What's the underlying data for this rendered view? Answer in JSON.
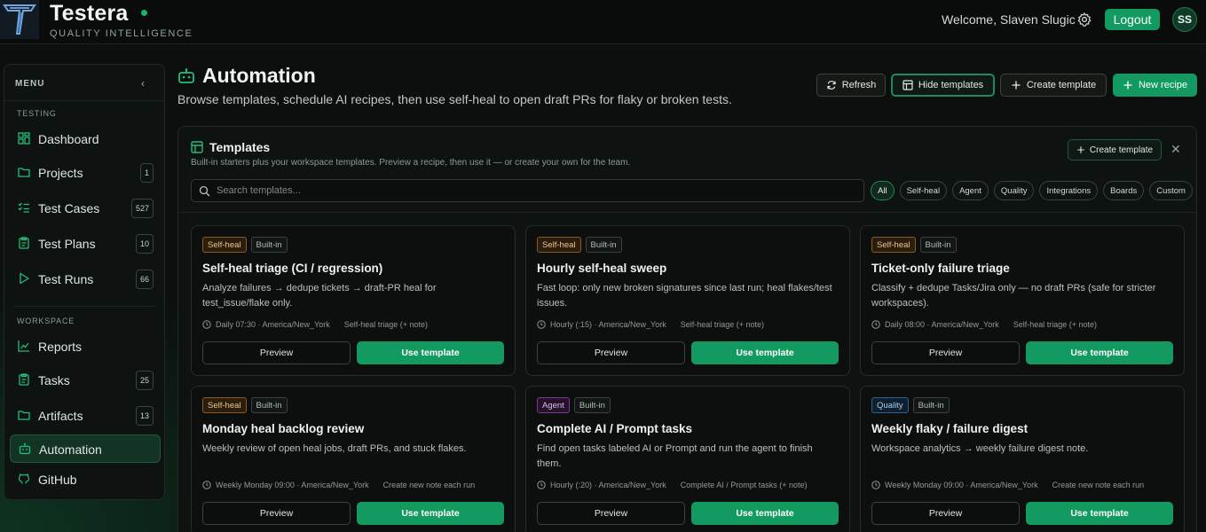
{
  "app": {
    "brand": "Testera",
    "tagline": "QUALITY INTELLIGENCE",
    "welcome": "Welcome, Slaven Slugic",
    "logout_label": "Logout",
    "avatar_initials": "SS",
    "accent_color": "#139a60"
  },
  "sidebar": {
    "menu_title": "MENU",
    "section_testing": "TESTING",
    "section_workspace": "WORKSPACE",
    "items": [
      {
        "label": "Dashboard",
        "icon": "dashboard-icon"
      },
      {
        "label": "Projects",
        "icon": "folder-icon",
        "badge": "1"
      },
      {
        "label": "Test Cases",
        "icon": "list-check-icon",
        "badge": "527"
      },
      {
        "label": "Test Plans",
        "icon": "clipboard-icon",
        "badge": "10"
      },
      {
        "label": "Test Runs",
        "icon": "play-icon",
        "badge": "66"
      },
      {
        "label": "Reports",
        "icon": "chart-line-icon"
      },
      {
        "label": "Tasks",
        "icon": "clipboard-icon",
        "badge": "25"
      },
      {
        "label": "Artifacts",
        "icon": "folder-icon",
        "badge": "13"
      },
      {
        "label": "Automation",
        "icon": "robot-icon",
        "active": true
      },
      {
        "label": "GitHub",
        "icon": "github-icon"
      }
    ]
  },
  "header": {
    "title": "Automation",
    "subtitle": "Browse templates, schedule AI recipes, then use self-heal to open draft PRs for flaky or broken tests.",
    "buttons": {
      "refresh": "Refresh",
      "hide_templates": "Hide templates",
      "create_template": "Create template",
      "new_recipe": "New recipe"
    }
  },
  "templates": {
    "title": "Templates",
    "description": "Built-in starters plus your workspace templates. Preview a recipe, then use it — or create your own for the team.",
    "create_label": "Create template",
    "search_placeholder": "Search templates...",
    "filters": [
      "All",
      "Self-heal",
      "Agent",
      "Quality",
      "Integrations",
      "Boards",
      "Custom"
    ],
    "active_filter": "All",
    "preview_label": "Preview",
    "use_label": "Use template",
    "cards": [
      {
        "tag": "Self-heal",
        "origin": "Built-in",
        "title": "Self-heal triage (CI / regression)",
        "description": "Analyze failures → dedupe tickets → draft-PR heal for test_issue/flake only.",
        "schedule": "Daily 07:30 · America/New_York",
        "action": "Self-heal triage (+ note)"
      },
      {
        "tag": "Self-heal",
        "origin": "Built-in",
        "title": "Hourly self-heal sweep",
        "description": "Fast loop: only new broken signatures since last run; heal flakes/test issues.",
        "schedule": "Hourly (:15) · America/New_York",
        "action": "Self-heal triage (+ note)"
      },
      {
        "tag": "Self-heal",
        "origin": "Built-in",
        "title": "Ticket-only failure triage",
        "description": "Classify + dedupe Tasks/Jira only — no draft PRs (safe for stricter workspaces).",
        "schedule": "Daily 08:00 · America/New_York",
        "action": "Self-heal triage (+ note)"
      },
      {
        "tag": "Self-heal",
        "origin": "Built-in",
        "title": "Monday heal backlog review",
        "description": "Weekly review of open heal jobs, draft PRs, and stuck flakes.",
        "schedule": "Weekly Monday 09:00 · America/New_York",
        "action": "Create new note each run"
      },
      {
        "tag": "Agent",
        "origin": "Built-in",
        "title": "Complete AI / Prompt tasks",
        "description": "Find open tasks labeled AI or Prompt and run the agent to finish them.",
        "schedule": "Hourly (:20) · America/New_York",
        "action": "Complete AI / Prompt tasks (+ note)"
      },
      {
        "tag": "Quality",
        "origin": "Built-in",
        "title": "Weekly flaky / failure digest",
        "description": "Workspace analytics → weekly failure digest note.",
        "schedule": "Weekly Monday 09:00 · America/New_York",
        "action": "Create new note each run"
      }
    ]
  }
}
